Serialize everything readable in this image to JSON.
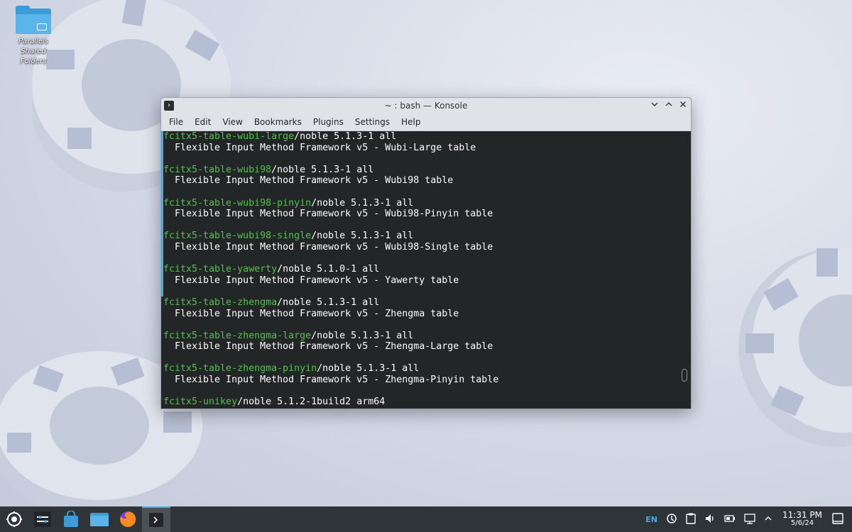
{
  "desktop": {
    "icon_label": "Parallels Shared Folders"
  },
  "window": {
    "title": "~ : bash — Konsole",
    "menu": [
      "File",
      "Edit",
      "View",
      "Bookmarks",
      "Plugins",
      "Settings",
      "Help"
    ]
  },
  "terminal": {
    "lines": [
      {
        "pkg": "fcitx5-table-wubi-large",
        "rest": "/noble 5.1.3-1 all"
      },
      {
        "pkg": "",
        "rest": "  Flexible Input Method Framework v5 - Wubi-Large table"
      },
      {
        "pkg": "",
        "rest": ""
      },
      {
        "pkg": "fcitx5-table-wubi98",
        "rest": "/noble 5.1.3-1 all"
      },
      {
        "pkg": "",
        "rest": "  Flexible Input Method Framework v5 - Wubi98 table"
      },
      {
        "pkg": "",
        "rest": ""
      },
      {
        "pkg": "fcitx5-table-wubi98-pinyin",
        "rest": "/noble 5.1.3-1 all"
      },
      {
        "pkg": "",
        "rest": "  Flexible Input Method Framework v5 - Wubi98-Pinyin table"
      },
      {
        "pkg": "",
        "rest": ""
      },
      {
        "pkg": "fcitx5-table-wubi98-single",
        "rest": "/noble 5.1.3-1 all"
      },
      {
        "pkg": "",
        "rest": "  Flexible Input Method Framework v5 - Wubi98-Single table"
      },
      {
        "pkg": "",
        "rest": ""
      },
      {
        "pkg": "fcitx5-table-yawerty",
        "rest": "/noble 5.1.0-1 all"
      },
      {
        "pkg": "",
        "rest": "  Flexible Input Method Framework v5 - Yawerty table"
      },
      {
        "pkg": "",
        "rest": ""
      },
      {
        "pkg": "fcitx5-table-zhengma",
        "rest": "/noble 5.1.3-1 all"
      },
      {
        "pkg": "",
        "rest": "  Flexible Input Method Framework v5 - Zhengma table"
      },
      {
        "pkg": "",
        "rest": ""
      },
      {
        "pkg": "fcitx5-table-zhengma-large",
        "rest": "/noble 5.1.3-1 all"
      },
      {
        "pkg": "",
        "rest": "  Flexible Input Method Framework v5 - Zhengma-Large table"
      },
      {
        "pkg": "",
        "rest": ""
      },
      {
        "pkg": "fcitx5-table-zhengma-pinyin",
        "rest": "/noble 5.1.3-1 all"
      },
      {
        "pkg": "",
        "rest": "  Flexible Input Method Framework v5 - Zhengma-Pinyin table"
      },
      {
        "pkg": "",
        "rest": ""
      },
      {
        "pkg": "fcitx5-unikey",
        "rest": "/noble 5.1.2-1build2 arm64"
      }
    ],
    "colors": {
      "package": "#55c04e",
      "text": "#fcfcfc",
      "background": "#232627"
    }
  },
  "taskbar": {
    "tray": {
      "language": "EN"
    },
    "clock": {
      "time": "11:31 PM",
      "date": "5/6/24"
    }
  }
}
